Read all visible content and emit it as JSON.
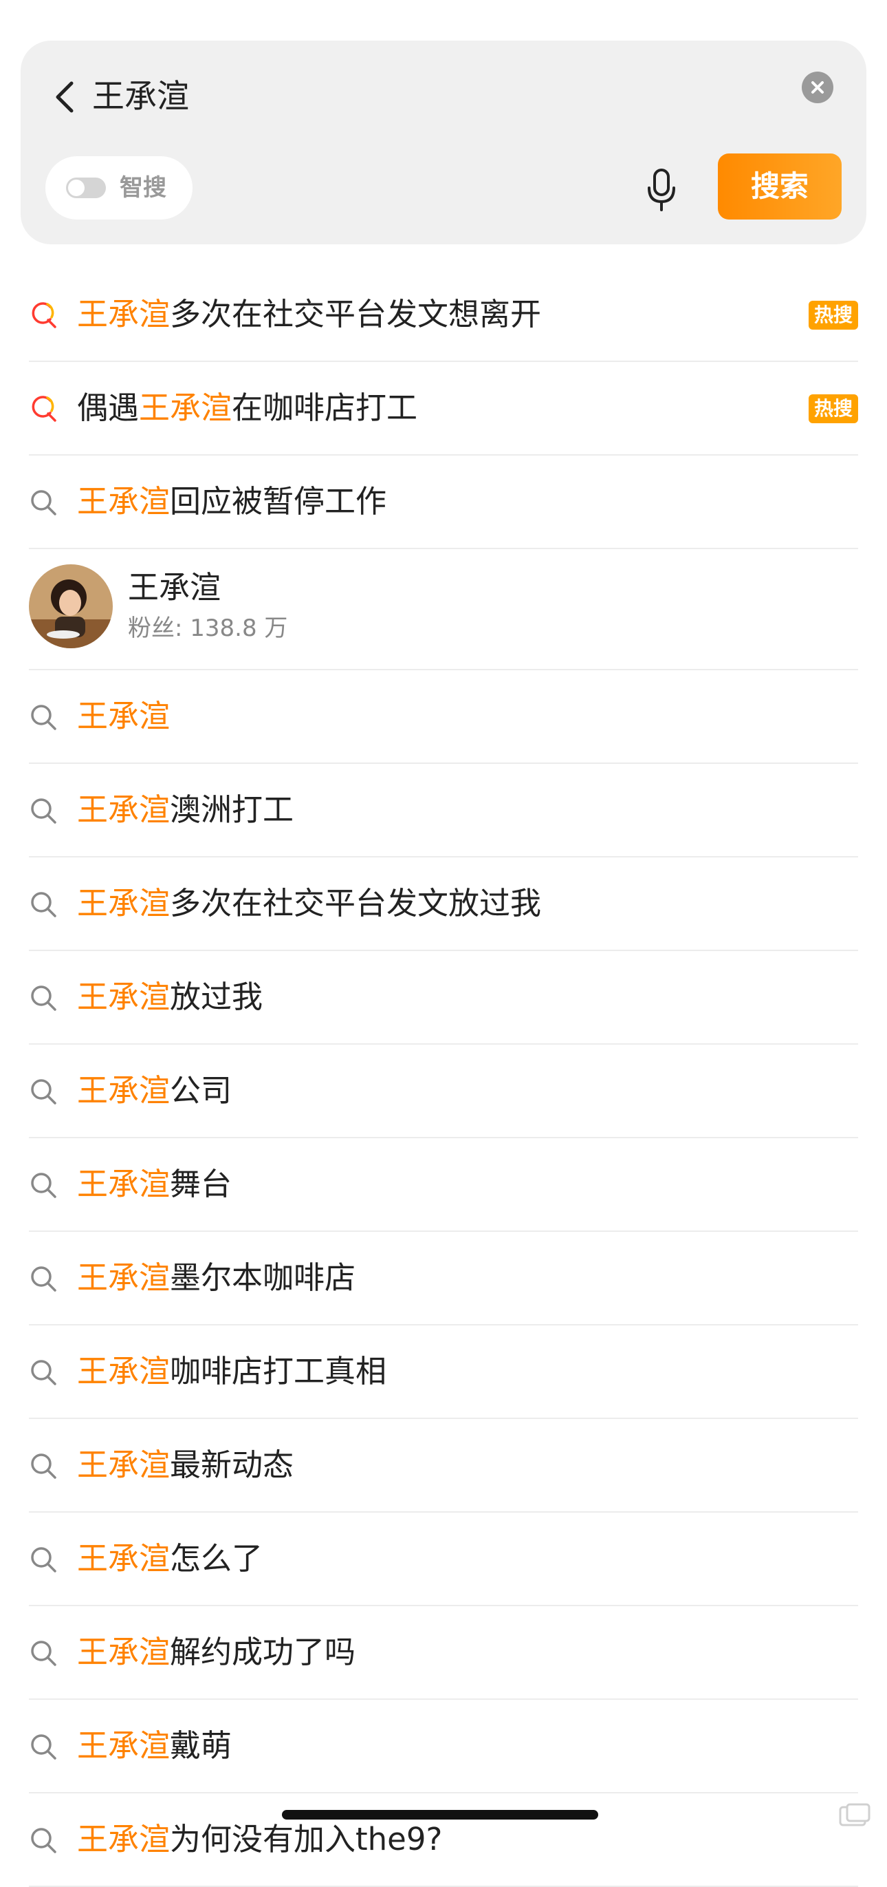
{
  "search": {
    "query": "王承渲",
    "smart_search_label": "智搜",
    "search_button_label": "搜索"
  },
  "colors": {
    "accent": "#ff8200",
    "hot_badge": "#ffa200",
    "search_button": "#ff8a00"
  },
  "suggestions": [
    {
      "type": "hot",
      "highlight": "王承渲",
      "text": "多次在社交平台发文想离开",
      "badge": "热搜"
    },
    {
      "type": "hot",
      "prefix": "偶遇",
      "highlight": "王承渲",
      "text": "在咖啡店打工",
      "badge": "热搜"
    },
    {
      "type": "normal",
      "highlight": "王承渲",
      "text": "回应被暂停工作"
    },
    {
      "type": "user",
      "name": "王承渲",
      "fans": "粉丝: 138.8 万"
    },
    {
      "type": "normal",
      "highlight": "王承渲",
      "text": ""
    },
    {
      "type": "normal",
      "highlight": "王承渲",
      "text": "澳洲打工"
    },
    {
      "type": "normal",
      "highlight": "王承渲",
      "text": "多次在社交平台发文放过我"
    },
    {
      "type": "normal",
      "highlight": "王承渲",
      "text": "放过我"
    },
    {
      "type": "normal",
      "highlight": "王承渲",
      "text": "公司"
    },
    {
      "type": "normal",
      "highlight": "王承渲",
      "text": "舞台"
    },
    {
      "type": "normal",
      "highlight": "王承渲",
      "text": "墨尔本咖啡店"
    },
    {
      "type": "normal",
      "highlight": "王承渲",
      "text": "咖啡店打工真相"
    },
    {
      "type": "normal",
      "highlight": "王承渲",
      "text": "最新动态"
    },
    {
      "type": "normal",
      "highlight": "王承渲",
      "text": "怎么了"
    },
    {
      "type": "normal",
      "highlight": "王承渲",
      "text": "解约成功了吗"
    },
    {
      "type": "normal",
      "highlight": "王承渲",
      "text": "戴萌"
    },
    {
      "type": "normal",
      "highlight": "王承渲",
      "text": "为何没有加入the9?"
    }
  ]
}
